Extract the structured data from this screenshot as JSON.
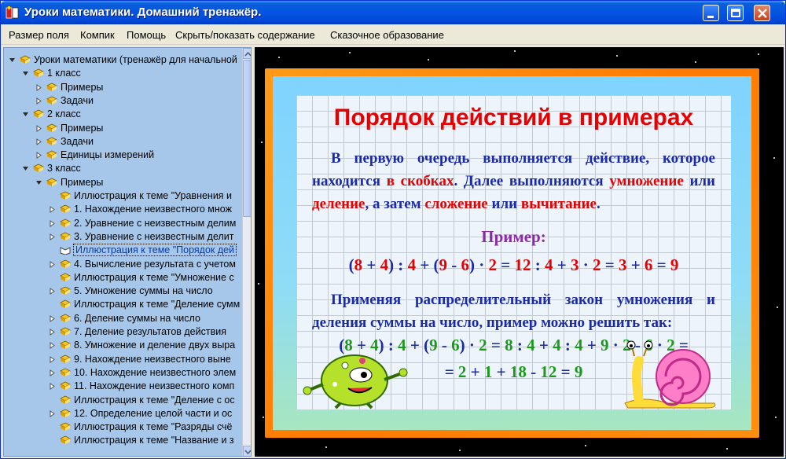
{
  "window": {
    "title": "Уроки математики. Домашний тренажёр."
  },
  "menu": [
    "Размер поля",
    "Компик",
    "Помощь",
    "Скрыть/показать содержание",
    "Сказочное образование"
  ],
  "tree": [
    {
      "label": "Уроки математики (тренажёр для начальной",
      "level": 0,
      "exp": "-"
    },
    {
      "label": "1 класс",
      "level": 1,
      "exp": "-"
    },
    {
      "label": "Примеры",
      "level": 2,
      "exp": "+"
    },
    {
      "label": "Задачи",
      "level": 2,
      "exp": "+"
    },
    {
      "label": "2 класс",
      "level": 1,
      "exp": "-"
    },
    {
      "label": "Примеры",
      "level": 2,
      "exp": "+"
    },
    {
      "label": "Задачи",
      "level": 2,
      "exp": "+"
    },
    {
      "label": "Единицы измерений",
      "level": 2,
      "exp": "+"
    },
    {
      "label": "3 класс",
      "level": 1,
      "exp": "-"
    },
    {
      "label": "Примеры",
      "level": 2,
      "exp": "-"
    },
    {
      "label": "Иллюстрация к теме \"Уравнения и",
      "level": 3,
      "exp": ""
    },
    {
      "label": "1. Нахождение неизвестного множ",
      "level": 3,
      "exp": "+"
    },
    {
      "label": "2. Уравнение с неизвестным делим",
      "level": 3,
      "exp": "+"
    },
    {
      "label": "3. Уравнение с неизвестным делит",
      "level": 3,
      "exp": "+"
    },
    {
      "label": "Иллюстрация к теме \"Порядок дей",
      "level": 3,
      "exp": "",
      "selected": true
    },
    {
      "label": "4. Вычисление результата с учетом",
      "level": 3,
      "exp": "+"
    },
    {
      "label": "Иллюстрация к теме \"Умножение с",
      "level": 3,
      "exp": ""
    },
    {
      "label": "5. Умножение суммы на число",
      "level": 3,
      "exp": "+"
    },
    {
      "label": "Иллюстрация к теме \"Деление сумм",
      "level": 3,
      "exp": ""
    },
    {
      "label": "6. Деление суммы на число",
      "level": 3,
      "exp": "+"
    },
    {
      "label": "7. Деление результатов действия",
      "level": 3,
      "exp": "+"
    },
    {
      "label": "8. Умножение и деление двух выра",
      "level": 3,
      "exp": "+"
    },
    {
      "label": "9. Нахождение неизвестного выне",
      "level": 3,
      "exp": "+"
    },
    {
      "label": "10. Нахождение неизвестного элем",
      "level": 3,
      "exp": "+"
    },
    {
      "label": "11. Нахождение неизвестного комп",
      "level": 3,
      "exp": "+"
    },
    {
      "label": "Иллюстрация к теме \"Деление с ос",
      "level": 3,
      "exp": ""
    },
    {
      "label": "12. Определение целой части и ос",
      "level": 3,
      "exp": "+"
    },
    {
      "label": "Иллюстрация к теме \"Разряды счё",
      "level": 3,
      "exp": ""
    },
    {
      "label": "Иллюстрация к теме \"Название и з",
      "level": 3,
      "exp": ""
    }
  ],
  "lesson": {
    "title": "Порядок действий в примерах",
    "p1": [
      {
        "t": "В первую очередь выполняется действие, которое находится ",
        "c": "blue"
      },
      {
        "t": "в скобках",
        "c": "red"
      },
      {
        "t": ". Далее выполняются ",
        "c": "blue"
      },
      {
        "t": "умножение",
        "c": "red"
      },
      {
        "t": " или ",
        "c": "blue"
      },
      {
        "t": "деление",
        "c": "red"
      },
      {
        "t": ", а затем ",
        "c": "blue"
      },
      {
        "t": "сложение",
        "c": "red"
      },
      {
        "t": " или ",
        "c": "blue"
      },
      {
        "t": "вычитание",
        "c": "red"
      },
      {
        "t": ".",
        "c": "blue"
      }
    ],
    "example_label": "Пример:",
    "example1": [
      {
        "t": "(",
        "c": "blue"
      },
      {
        "t": "8",
        "c": "red"
      },
      {
        "t": " + ",
        "c": "blue"
      },
      {
        "t": "4",
        "c": "red"
      },
      {
        "t": ") : ",
        "c": "blue"
      },
      {
        "t": "4",
        "c": "red"
      },
      {
        "t": " + (",
        "c": "blue"
      },
      {
        "t": "9",
        "c": "red"
      },
      {
        "t": " - ",
        "c": "blue"
      },
      {
        "t": "6",
        "c": "red"
      },
      {
        "t": ") · ",
        "c": "blue"
      },
      {
        "t": "2",
        "c": "red"
      },
      {
        "t": " = ",
        "c": "blue"
      },
      {
        "t": "12",
        "c": "red"
      },
      {
        "t": " : ",
        "c": "blue"
      },
      {
        "t": "4",
        "c": "red"
      },
      {
        "t": " + ",
        "c": "blue"
      },
      {
        "t": "3",
        "c": "red"
      },
      {
        "t": " · ",
        "c": "blue"
      },
      {
        "t": "2",
        "c": "red"
      },
      {
        "t": " = ",
        "c": "blue"
      },
      {
        "t": "3",
        "c": "red"
      },
      {
        "t": " + ",
        "c": "blue"
      },
      {
        "t": "6",
        "c": "red"
      },
      {
        "t": " = ",
        "c": "blue"
      },
      {
        "t": "9",
        "c": "red"
      }
    ],
    "p2": "Применяя распределительный закон умножения и деления суммы на число, пример можно решить так:",
    "example2_line1": [
      {
        "t": "(",
        "c": "blue"
      },
      {
        "t": "8",
        "c": "green"
      },
      {
        "t": " + ",
        "c": "blue"
      },
      {
        "t": "4",
        "c": "green"
      },
      {
        "t": ") : ",
        "c": "blue"
      },
      {
        "t": "4",
        "c": "green"
      },
      {
        "t": " + (",
        "c": "blue"
      },
      {
        "t": "9",
        "c": "green"
      },
      {
        "t": " - ",
        "c": "blue"
      },
      {
        "t": "6",
        "c": "green"
      },
      {
        "t": ") · ",
        "c": "blue"
      },
      {
        "t": "2",
        "c": "green"
      },
      {
        "t": " = ",
        "c": "blue"
      },
      {
        "t": "8",
        "c": "green"
      },
      {
        "t": " : ",
        "c": "blue"
      },
      {
        "t": "4",
        "c": "green"
      },
      {
        "t": " + ",
        "c": "blue"
      },
      {
        "t": "4",
        "c": "green"
      },
      {
        "t": " : ",
        "c": "blue"
      },
      {
        "t": "4",
        "c": "green"
      },
      {
        "t": " + ",
        "c": "blue"
      },
      {
        "t": "9",
        "c": "green"
      },
      {
        "t": " · ",
        "c": "blue"
      },
      {
        "t": "2",
        "c": "green"
      },
      {
        "t": " - ",
        "c": "blue"
      },
      {
        "t": "6",
        "c": "green"
      },
      {
        "t": " · ",
        "c": "blue"
      },
      {
        "t": "2",
        "c": "green"
      },
      {
        "t": " =",
        "c": "blue"
      }
    ],
    "example2_line2": [
      {
        "t": "= ",
        "c": "blue"
      },
      {
        "t": "2",
        "c": "green"
      },
      {
        "t": " + ",
        "c": "blue"
      },
      {
        "t": "1",
        "c": "green"
      },
      {
        "t": " + ",
        "c": "blue"
      },
      {
        "t": "18",
        "c": "green"
      },
      {
        "t": " - ",
        "c": "blue"
      },
      {
        "t": "12",
        "c": "green"
      },
      {
        "t": " = ",
        "c": "blue"
      },
      {
        "t": "9",
        "c": "green"
      }
    ]
  },
  "colors": {
    "red": "#e60000",
    "blue": "#1a2aa8",
    "green": "#1a9a1a",
    "purple": "#8a2ca8",
    "frame": "#ff8a00"
  },
  "icons": [
    "app-icon",
    "minimize-icon",
    "maximize-icon",
    "close-icon",
    "folder-book-icon",
    "expand-icon",
    "collapse-icon",
    "page-icon"
  ]
}
